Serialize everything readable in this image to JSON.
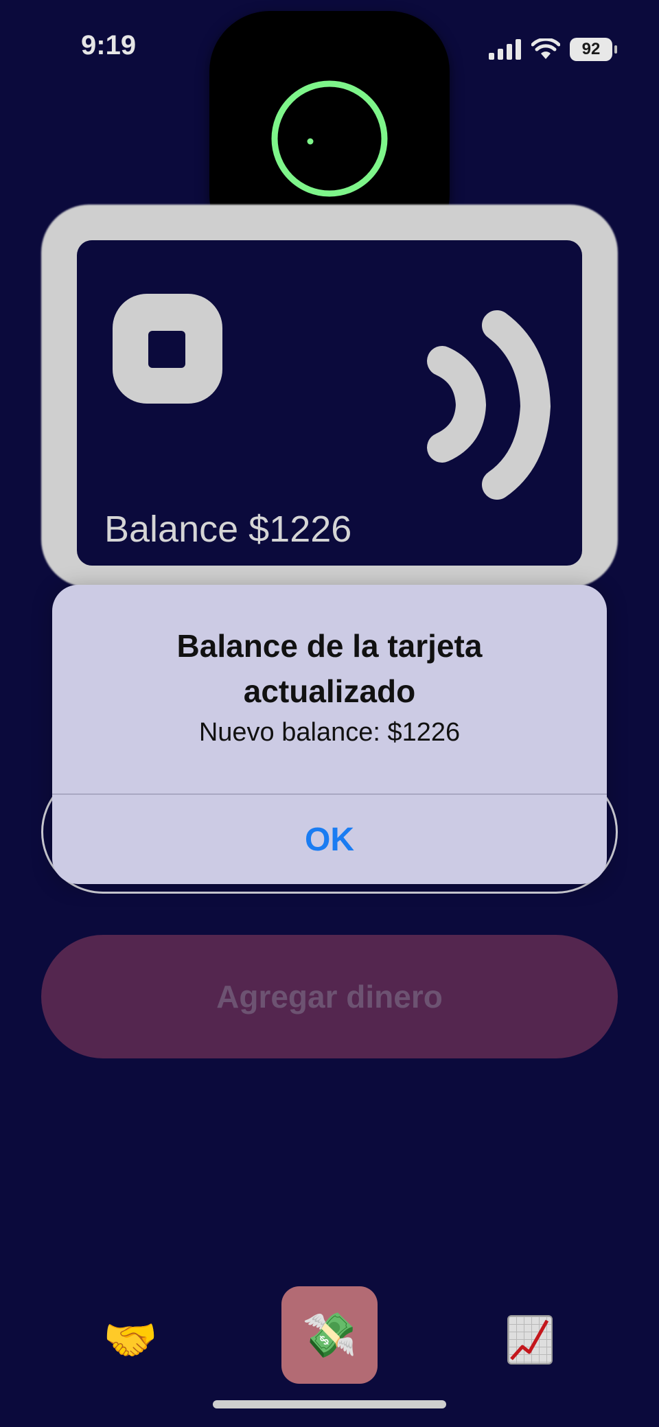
{
  "status_bar": {
    "time": "9:19",
    "battery": "92"
  },
  "card": {
    "balance_text": "Balance $1226"
  },
  "alert": {
    "title": "Balance de la tarjeta actualizado",
    "message": "Nuevo balance: $1226",
    "ok_label": "OK"
  },
  "actions": {
    "add_money_label": "Agregar dinero"
  },
  "tab_bar": {
    "items": [
      {
        "icon": "handshake-icon",
        "glyph": "🤝"
      },
      {
        "icon": "money-with-wings-icon",
        "glyph": "💸"
      },
      {
        "icon": "chart-increasing-icon",
        "glyph": ""
      }
    ]
  },
  "colors": {
    "background": "#0b0a3c",
    "accent_ring": "#7ef58a",
    "alert_button": "#1a7cf2",
    "primary_button": "#54264f",
    "selected_tab": "#b36b74"
  }
}
